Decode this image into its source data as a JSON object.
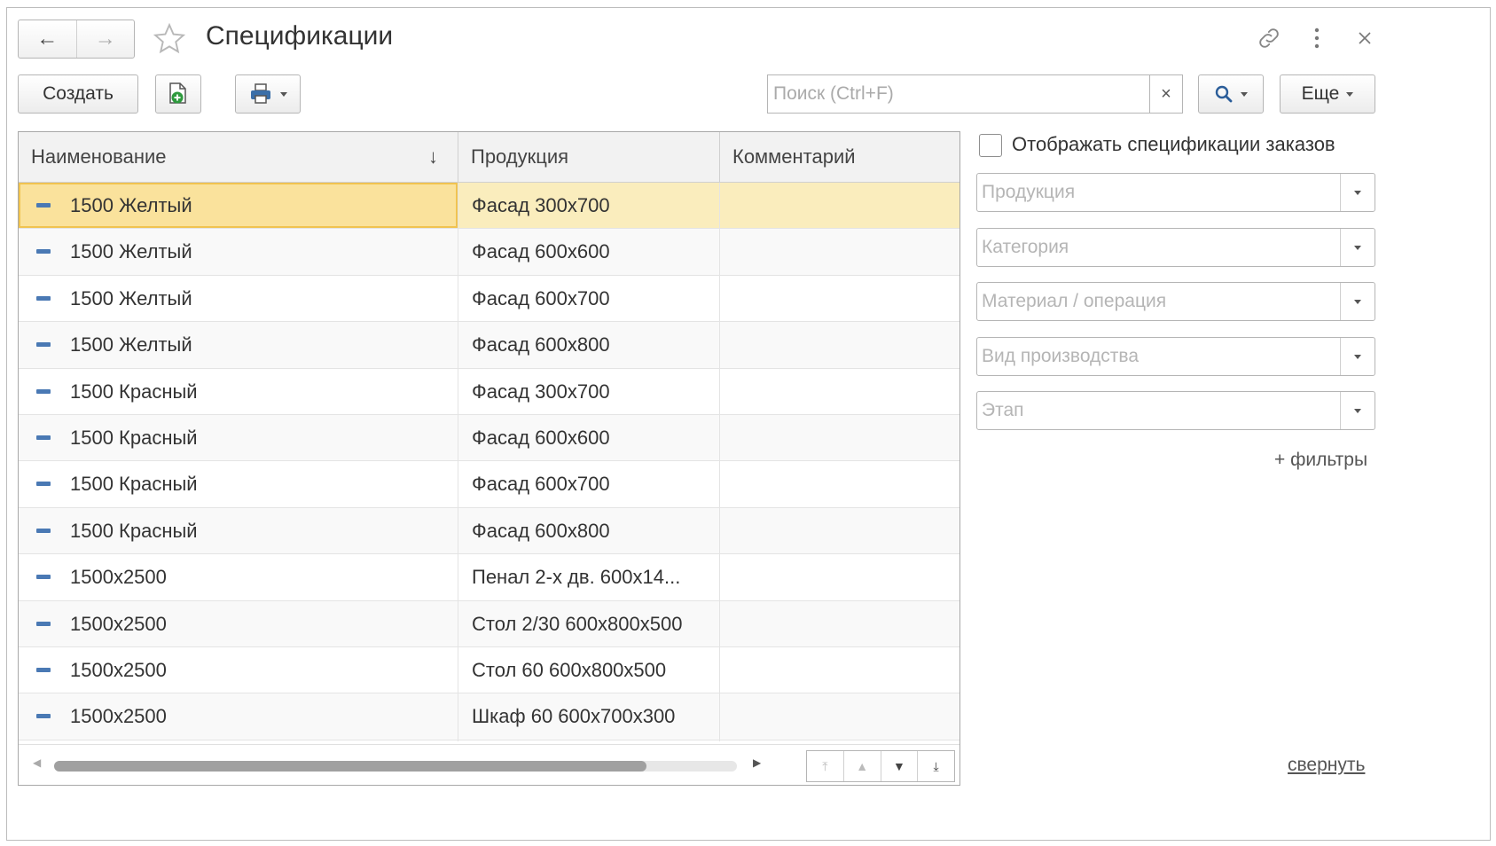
{
  "header": {
    "title": "Спецификации",
    "back_icon": "arrow-left-icon",
    "forward_icon": "arrow-right-icon"
  },
  "toolbar": {
    "create_label": "Создать",
    "search_placeholder": "Поиск (Ctrl+F)",
    "search_clear": "×",
    "more_label": "Еще"
  },
  "table": {
    "columns": [
      "Наименование",
      "Продукция",
      "Комментарий"
    ],
    "sort_indicator": "↓",
    "rows": [
      {
        "name": "1500 Желтый",
        "product": "Фасад 300x700",
        "comment": ""
      },
      {
        "name": "1500 Желтый",
        "product": "Фасад 600x600",
        "comment": ""
      },
      {
        "name": "1500 Желтый",
        "product": "Фасад 600x700",
        "comment": ""
      },
      {
        "name": "1500 Желтый",
        "product": "Фасад 600x800",
        "comment": ""
      },
      {
        "name": "1500 Красный",
        "product": "Фасад 300x700",
        "comment": ""
      },
      {
        "name": "1500 Красный",
        "product": "Фасад 600x600",
        "comment": ""
      },
      {
        "name": "1500 Красный",
        "product": "Фасад 600x700",
        "comment": ""
      },
      {
        "name": "1500 Красный",
        "product": "Фасад 600x800",
        "comment": ""
      },
      {
        "name": "1500x2500",
        "product": "Пенал 2-х дв. 600x14...",
        "comment": ""
      },
      {
        "name": "1500x2500",
        "product": "Стол 2/30 600x800x500",
        "comment": ""
      },
      {
        "name": "1500x2500",
        "product": "Стол 60 600x800x500",
        "comment": ""
      },
      {
        "name": "1500x2500",
        "product": "Шкаф 60 600x700x300",
        "comment": ""
      }
    ]
  },
  "filters": {
    "show_orders_label": "Отображать спецификации заказов",
    "show_orders_checked": false,
    "fields": [
      "Продукция",
      "Категория",
      "Материал / операция",
      "Вид производства",
      "Этап"
    ],
    "add_filters_label": "+ фильтры",
    "collapse_label": "свернуть"
  },
  "colors": {
    "selected_row": "#faedbd",
    "selected_cell": "#fae29c",
    "row_marker": "#4a79b4"
  }
}
